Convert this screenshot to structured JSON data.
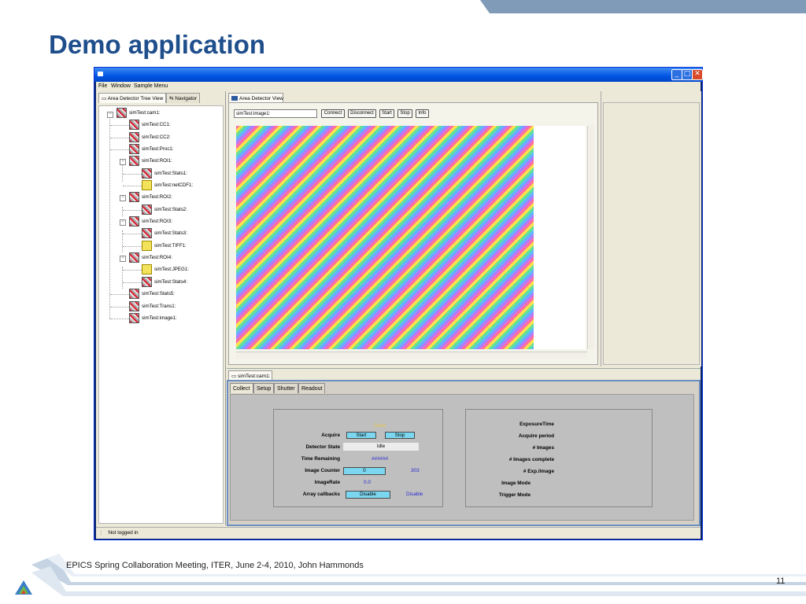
{
  "slide": {
    "title": "Demo application",
    "footer": "EPICS Spring Collaboration Meeting, ITER, June 2-4, 2010, John Hammonds",
    "page_number": "11"
  },
  "window": {
    "minimize": "_",
    "maximize": "□",
    "close": "✕"
  },
  "menubar": {
    "items": [
      "File",
      "Window",
      "Sample Menu"
    ]
  },
  "left_panel": {
    "tabs": [
      "Area Detector Tree View",
      "Navigator"
    ],
    "tree": [
      {
        "label": "simTest:cam1:",
        "icon": "gray"
      },
      {
        "label": "simTest:CC1:",
        "icon": "gray"
      },
      {
        "label": "simTest:CC2:",
        "icon": "gray"
      },
      {
        "label": "simTest:Proc1:",
        "icon": "gray"
      },
      {
        "label": "simTest:ROI1:",
        "icon": "gray"
      },
      {
        "label": "simTest:Stats1:",
        "icon": "gray"
      },
      {
        "label": "simTest:netCDF1:",
        "icon": "yellow"
      },
      {
        "label": "simTest:ROI2:",
        "icon": "gray"
      },
      {
        "label": "simTest:Stats2:",
        "icon": "gray"
      },
      {
        "label": "simTest:ROI3:",
        "icon": "gray"
      },
      {
        "label": "simTest:Stats3:",
        "icon": "gray"
      },
      {
        "label": "simTest:TIFF1:",
        "icon": "yellow"
      },
      {
        "label": "simTest:ROI4:",
        "icon": "gray"
      },
      {
        "label": "simTest:JPEG1:",
        "icon": "yellow"
      },
      {
        "label": "simTest:Stats4:",
        "icon": "gray"
      },
      {
        "label": "simTest:Stats5:",
        "icon": "gray"
      },
      {
        "label": "simTest:Trans1:",
        "icon": "gray"
      },
      {
        "label": "simTest:image1:",
        "icon": "gray"
      }
    ]
  },
  "area_detector_view": {
    "tab": "Area Detector View",
    "pv_input": "simTest:image1:",
    "buttons": [
      "Connect",
      "Disconnect",
      "Start",
      "Stop",
      "Info"
    ]
  },
  "bottom": {
    "tab": "simTest:cam1:",
    "subtabs": [
      "Collect",
      "Setup",
      "Shutter",
      "Readout"
    ],
    "collect": {
      "status_text": "Done",
      "acquire_label": "Acquire",
      "start_button": "Start",
      "stop_button": "Stop",
      "detector_state_label": "Detector State",
      "detector_state_value": "Idle",
      "time_remaining_label": "Time Remaining",
      "time_remaining_value": "######",
      "image_counter_label": "Image Counter",
      "image_counter_value": "0",
      "image_counter_readback": "303",
      "image_rate_label": "ImageRate",
      "image_rate_value": "0.0",
      "array_callbacks_label": "Array callbacks",
      "array_callbacks_button": "Disable",
      "array_callbacks_readback": "Disable"
    },
    "settings": {
      "labels": [
        "ExposureTime",
        "Acquire period",
        "# Images",
        "# Images complete",
        "# Exp./image",
        "Image Mode",
        "Trigger Mode"
      ]
    }
  },
  "status_bar": {
    "text": "Not logged in"
  },
  "colors": {
    "title_blue": "#1f4e8c",
    "titlebar_blue": "#0054e3",
    "medm_button": "#7bd7f0",
    "readback_blue": "#2a2ad2",
    "done_yellow": "#e6c84a"
  }
}
